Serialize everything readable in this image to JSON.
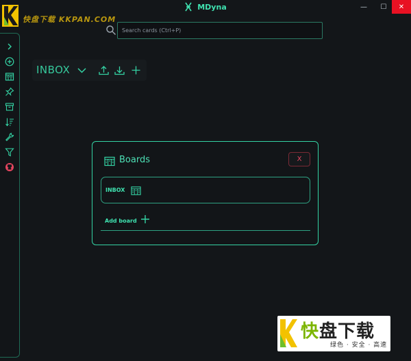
{
  "window": {
    "title": "MDyna",
    "minimize": "—",
    "maximize": "☐",
    "close": "✕"
  },
  "watermark_top": {
    "text": "快盘下载 KKPAN.COM"
  },
  "search": {
    "placeholder": "Search cards (Ctrl+P)"
  },
  "sidebar": {
    "items": [
      {
        "icon": "chevron-right-icon"
      },
      {
        "icon": "add-circle-icon"
      },
      {
        "icon": "board-icon"
      },
      {
        "icon": "pin-icon"
      },
      {
        "icon": "archive-icon"
      },
      {
        "icon": "sort-icon"
      },
      {
        "icon": "wrench-icon"
      },
      {
        "icon": "filter-icon"
      },
      {
        "icon": "github-icon"
      }
    ]
  },
  "board": {
    "name": "INBOX"
  },
  "modal": {
    "title": "Boards",
    "close_label": "X",
    "boards": [
      {
        "label": "INBOX"
      }
    ],
    "add_label": "Add board"
  },
  "watermark_bottom": {
    "title_prefix": "快",
    "title_rest": "盘下载",
    "subtitle": "绿色 · 安全 · 高速"
  },
  "colors": {
    "background": "#131619",
    "accent": "#34d3a4",
    "close_red": "#e5455f",
    "window_close": "#e81123",
    "github": "#e5455f"
  }
}
